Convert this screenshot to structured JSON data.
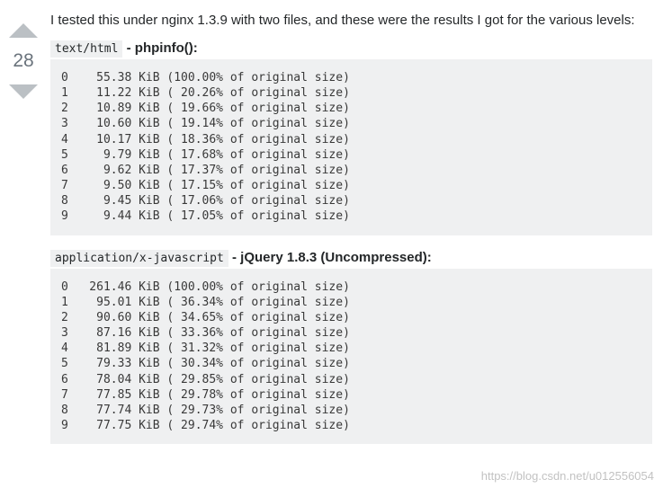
{
  "vote": {
    "count": "28"
  },
  "intro": "I tested this under nginx 1.3.9 with two files, and these were the results I got for the various levels:",
  "section1": {
    "mime": "text/html",
    "label": " - phpinfo():",
    "rows": [
      {
        "level": "0",
        "size": " 55.38",
        "pct": "100.00"
      },
      {
        "level": "1",
        "size": " 11.22",
        "pct": " 20.26"
      },
      {
        "level": "2",
        "size": " 10.89",
        "pct": " 19.66"
      },
      {
        "level": "3",
        "size": " 10.60",
        "pct": " 19.14"
      },
      {
        "level": "4",
        "size": " 10.17",
        "pct": " 18.36"
      },
      {
        "level": "5",
        "size": "  9.79",
        "pct": " 17.68"
      },
      {
        "level": "6",
        "size": "  9.62",
        "pct": " 17.37"
      },
      {
        "level": "7",
        "size": "  9.50",
        "pct": " 17.15"
      },
      {
        "level": "8",
        "size": "  9.45",
        "pct": " 17.06"
      },
      {
        "level": "9",
        "size": "  9.44",
        "pct": " 17.05"
      }
    ]
  },
  "section2": {
    "mime": "application/x-javascript",
    "label": " - jQuery 1.8.3 (Uncompressed):",
    "rows": [
      {
        "level": "0",
        "size": "261.46",
        "pct": "100.00"
      },
      {
        "level": "1",
        "size": " 95.01",
        "pct": " 36.34"
      },
      {
        "level": "2",
        "size": " 90.60",
        "pct": " 34.65"
      },
      {
        "level": "3",
        "size": " 87.16",
        "pct": " 33.36"
      },
      {
        "level": "4",
        "size": " 81.89",
        "pct": " 31.32"
      },
      {
        "level": "5",
        "size": " 79.33",
        "pct": " 30.34"
      },
      {
        "level": "6",
        "size": " 78.04",
        "pct": " 29.85"
      },
      {
        "level": "7",
        "size": " 77.85",
        "pct": " 29.78"
      },
      {
        "level": "8",
        "size": " 77.74",
        "pct": " 29.73"
      },
      {
        "level": "9",
        "size": " 77.75",
        "pct": " 29.74"
      }
    ]
  },
  "watermark": "https://blog.csdn.net/u012556054"
}
